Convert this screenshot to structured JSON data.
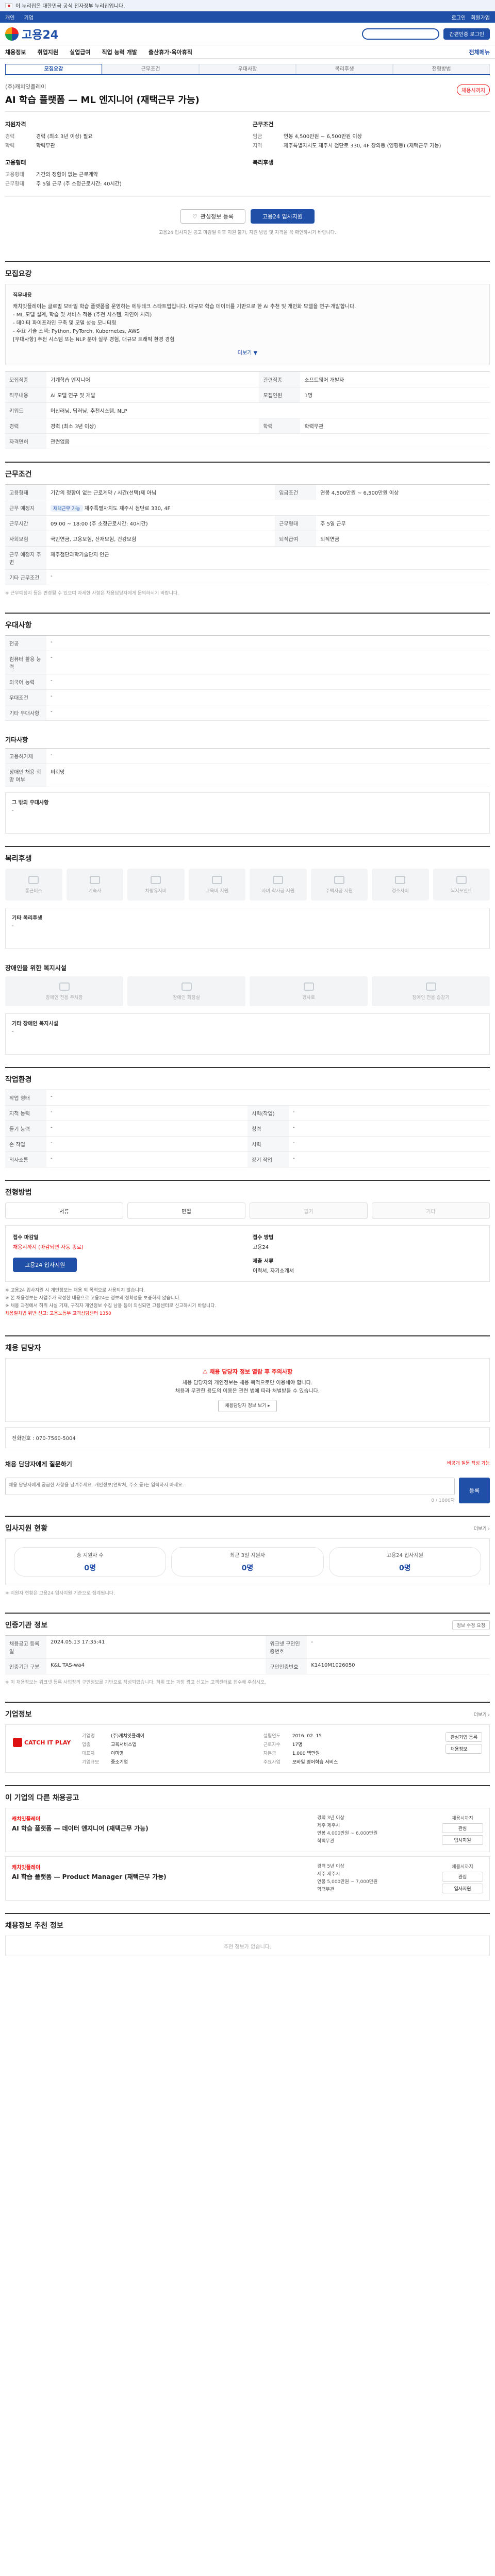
{
  "topbar": {
    "notice": "이 누리집은 대한민국 공식 전자정부 누리집입니다."
  },
  "navbar": {
    "items": [
      "개인",
      "기업"
    ],
    "right": [
      "로그인",
      "회원가입"
    ]
  },
  "brand": {
    "logo": "고용24",
    "apply_btn": "간편인증 로그인"
  },
  "menu": {
    "items": [
      "채용정보",
      "취업지원",
      "실업급여",
      "직업 능력 개발",
      "출산휴가·육아휴직"
    ],
    "right": "전체메뉴"
  },
  "tabs": [
    "모집요강",
    "근무조건",
    "우대사항",
    "복리후생",
    "전형방법"
  ],
  "job": {
    "company": "(주)캐치잇플레이",
    "title": "AI 학습 플랫폼 — ML 엔지니어 (재택근무 가능)",
    "dday": "채용시까지",
    "summary": {
      "left_head": "지원자격",
      "left_rows": [
        {
          "k": "경력",
          "v": "경력 (최소 3년 이상) 필요"
        },
        {
          "k": "학력",
          "v": "학력무관"
        }
      ],
      "right_head": "근무조건",
      "right_rows": [
        {
          "k": "임금",
          "v": "연봉 4,500만원 ~ 6,500만원 이상"
        },
        {
          "k": "지역",
          "v": "제주특별자치도 제주시 첨단로 330, 4F 창의동 (영평동) (재택근무 가능)"
        }
      ],
      "left_head2": "고용형태",
      "left_rows2": [
        {
          "k": "고용형태",
          "v": "기간의 정함이 없는 근로계약"
        },
        {
          "k": "근무형태",
          "v": "주 5일 근무 (주 소정근로시간: 40시간)"
        }
      ],
      "right_head2": "복리후생",
      "right_rows2": []
    },
    "btn_save": "관심정보 등록",
    "btn_apply": "고용24 입사지원",
    "notice": "고용24 입사지원 공고 마감일 이후 지원 불가, 지원 방법 및 자격을 꼭 확인하시기 바랍니다."
  },
  "recruit": {
    "title": "모집요강",
    "desc_head": "직무내용",
    "desc_lines": [
      "캐치잇플레이는 글로벌 모바일 학습 플랫폼을 운영하는 에듀테크 스타트업입니다. 대규모 학습 데이터를 기반으로 한 AI 추천 및 개인화 모델을 연구·개발합니다.",
      "- ML 모델 설계, 학습 및 서비스 적용 (추천 시스템, 자연어 처리)",
      "- 데이터 파이프라인 구축 및 모델 성능 모니터링",
      "- 주요 기술 스택: Python, PyTorch, Kubernetes, AWS",
      "[우대사항] 추천 시스템 또는 NLP 분야 실무 경험, 대규모 트래픽 환경 경험"
    ],
    "desc_footer": "더보기 ▼",
    "rows": [
      {
        "k": "모집직종",
        "v": "기계학습 엔지니어",
        "k2": "관련직종",
        "v2": "소프트웨어 개발자"
      },
      {
        "k": "직무내용",
        "v": "AI 모델 연구 및 개발",
        "k2": "모집인원",
        "v2": "1명"
      },
      {
        "k": "키워드",
        "v": "머신러닝, 딥러닝, 추천시스템, NLP",
        "k2": "",
        "v2": ""
      },
      {
        "k": "경력",
        "v": "경력 (최소 3년 이상)",
        "k2": "학력",
        "v2": "학력무관"
      },
      {
        "k": "자격면허",
        "v": "관련없음",
        "k2": "",
        "v2": ""
      }
    ]
  },
  "conditions": {
    "title": "근무조건",
    "rows": [
      {
        "k": "고용형태",
        "v": "기간의 정함이 없는 근로계약 / 시간(선택)제 아님",
        "k2": "임금조건",
        "v2": "연봉 4,500만원 ~ 6,500만원 이상"
      },
      {
        "k": "근무 예정지",
        "v": "제주특별자치도 제주시 첨단로 330, 4F",
        "badge": "재택근무 가능",
        "k2": "",
        "v2": ""
      },
      {
        "k": "근무시간",
        "v": "09:00 ~ 18:00 (주 소정근로시간: 40시간)",
        "k2": "근무형태",
        "v2": "주 5일 근무"
      },
      {
        "k": "사회보험",
        "v": "국민연금, 고용보험, 산재보험, 건강보험",
        "k2": "퇴직급여",
        "v2": "퇴직연금"
      },
      {
        "k": "근무 예정지 주변",
        "v": "제주첨단과학기술단지 인근",
        "k2": "",
        "v2": ""
      },
      {
        "k": "기타 근무조건",
        "v": "-",
        "k2": "",
        "v2": ""
      }
    ],
    "note": "※ 근무예정지 등은 변경될 수 있으며 자세한 사항은 채용담당자에게 문의하시기 바랍니다."
  },
  "preferred": {
    "title": "우대사항",
    "rows": [
      {
        "k": "전공",
        "v": "-"
      },
      {
        "k": "컴퓨터 활용 능력",
        "v": "-"
      },
      {
        "k": "외국어 능력",
        "v": "-"
      },
      {
        "k": "우대조건",
        "v": "-"
      },
      {
        "k": "기타 우대사항",
        "v": "-"
      }
    ]
  },
  "other": {
    "title": "기타사항",
    "rows": [
      {
        "k": "고용허가제",
        "v": "-"
      },
      {
        "k": "장애인 채용 희망 여부",
        "v": "비희망"
      }
    ],
    "box_head": "그 밖의 우대사항",
    "box_text": "-"
  },
  "welfare": {
    "title": "복리후생",
    "items": [
      "통근버스",
      "기숙사",
      "차량유지비",
      "교육비 지원",
      "자녀 학자금 지원",
      "주택자금 지원",
      "경조사비",
      "복지포인트"
    ],
    "box_head": "기타 복리후생",
    "box_text": "-"
  },
  "disability": {
    "title": "장애인을 위한 복지시설",
    "items": [
      "장애인 전용 주차장",
      "장애인 화장실",
      "경사로",
      "장애인 전용 승강기"
    ],
    "box_head": "기타 장애인 복지시설",
    "box_text": "-"
  },
  "environment": {
    "title": "작업환경",
    "rows": [
      {
        "k": "작업 형태",
        "v": "-",
        "k2": "",
        "v2": ""
      },
      {
        "k": "지적 능력",
        "v": "-",
        "k2": "시력(작업)",
        "v2": "-"
      },
      {
        "k": "들기 능력",
        "v": "-",
        "k2": "청력",
        "v2": "-"
      },
      {
        "k": "손 작업",
        "v": "-",
        "k2": "시력",
        "v2": "-"
      },
      {
        "k": "의사소통",
        "v": "-",
        "k2": "장기 작업",
        "v2": "-"
      }
    ]
  },
  "selection": {
    "title": "전형방법",
    "methods": [
      {
        "label": "서류",
        "on": true
      },
      {
        "label": "면접",
        "on": true
      },
      {
        "label": "필기",
        "on": false
      },
      {
        "label": "기타",
        "on": false
      }
    ],
    "apply_label": "접수 마감일",
    "apply_value": "채용시까지",
    "apply_red": "채용시까지 (마감되면 자동 종료)",
    "apply_btn": "고용24 입사지원",
    "method_label": "접수 방법",
    "method_value": "고용24",
    "docs_label": "제출 서류",
    "docs_value": "이력서, 자기소개서",
    "warnings": [
      "※ 고용24 입사지원 시 개인정보는 채용 외 목적으로 사용되지 않습니다.",
      "※ 본 채용정보는 사업주가 작성한 내용으로 고용24는 정보의 정확성을 보증하지 않습니다.",
      "※ 채용 과정에서 허위 사실 기재, 구직자 개인정보 수집 남용 등이 의심되면 고용센터로 신고하시기 바랍니다."
    ],
    "warning_red": "채용절차법 위반 신고: 고용노동부 고객상담센터 1350"
  },
  "contact": {
    "title": "채용 담당자",
    "alert": "채용 담당자 정보 열람 후 주의사항",
    "lines": [
      "채용 담당자의 개인정보는 채용 목적으로만 이용해야 합니다.",
      "채용과 무관한 용도의 이용은 관련 법에 따라 처벌받을 수 있습니다."
    ],
    "link": "채용담당자 정보 보기 ▸",
    "contact_label": "전화번호",
    "contact_value": "070-7560-5004"
  },
  "inquiry": {
    "title": "채용 담당자에게 질문하기",
    "right_note": "비공개 질문 작성 가능",
    "placeholder": "채용 담당자에게 궁금한 사항을 남겨주세요. 개인정보(연락처, 주소 등)는 입력하지 마세요.",
    "counter": "0 / 1000자",
    "send": "등록"
  },
  "stats": {
    "title": "입사지원 현황",
    "more": "더보기 ›",
    "items": [
      {
        "label": "총 지원자 수",
        "num": "0명"
      },
      {
        "label": "최근 3일 지원자",
        "num": "0명"
      },
      {
        "label": "고용24 입사지원",
        "num": "0명"
      }
    ],
    "note": "※ 지원자 현황은 고용24 입사지원 기준으로 집계됩니다."
  },
  "manage": {
    "title": "인증기관 정보",
    "right_btn": "정보 수정 요청",
    "rows": [
      {
        "k": "채용공고 등록일",
        "v": "2024.05.13 17:35:41",
        "k2": "워크넷 구인인증번호",
        "v2": "-"
      },
      {
        "k": "인증기관 구분",
        "v": "K&L TAS-wa4",
        "k2": "구인인증번호",
        "v2": "K1410M1026050"
      }
    ],
    "note": "※ 이 채용정보는 워크넷 등록 사업장의 구인정보를 기반으로 작성되었습니다. 허위 또는 과장 광고 신고는 고객센터로 접수해 주십시오."
  },
  "company": {
    "title": "기업정보",
    "more": "더보기 ›",
    "logo": "CATCH IT PLAY",
    "info": [
      {
        "k": "기업명",
        "v": "(주)캐치잇플레이"
      },
      {
        "k": "설립연도",
        "v": "2016. 02. 15"
      },
      {
        "k": "업종",
        "v": "교육서비스업"
      },
      {
        "k": "근로자수",
        "v": "17명"
      },
      {
        "k": "대표자",
        "v": "이미영"
      },
      {
        "k": "자본금",
        "v": "1,000 백만원"
      },
      {
        "k": "기업규모",
        "v": "중소기업"
      },
      {
        "k": "주요사업",
        "v": "모바일 영어학습 서비스"
      }
    ],
    "actions": [
      "관심기업 등록",
      "채용정보"
    ]
  },
  "more_jobs": {
    "title": "이 기업의 다른 채용공고",
    "cards": [
      {
        "comp": "캐치잇플레이",
        "title": "AI 학습 플랫폼 — 데이터 엔지니어 (재택근무 가능)",
        "info": [
          "경력 3년 이상",
          "제주 제주시",
          "연봉 4,000만원 ~ 6,000만원",
          "학력무관"
        ],
        "dday": "채용시까지",
        "btns": [
          "관심",
          "입사지원"
        ]
      },
      {
        "comp": "캐치잇플레이",
        "title": "AI 학습 플랫폼 — Product Manager (재택근무 가능)",
        "info": [
          "경력 5년 이상",
          "제주 제주시",
          "연봉 5,000만원 ~ 7,000만원",
          "학력무관"
        ],
        "dday": "채용시까지",
        "btns": [
          "관심",
          "입사지원"
        ]
      }
    ]
  },
  "recommended": {
    "title": "채용정보 추천 정보",
    "empty": "추천 정보가 없습니다."
  }
}
